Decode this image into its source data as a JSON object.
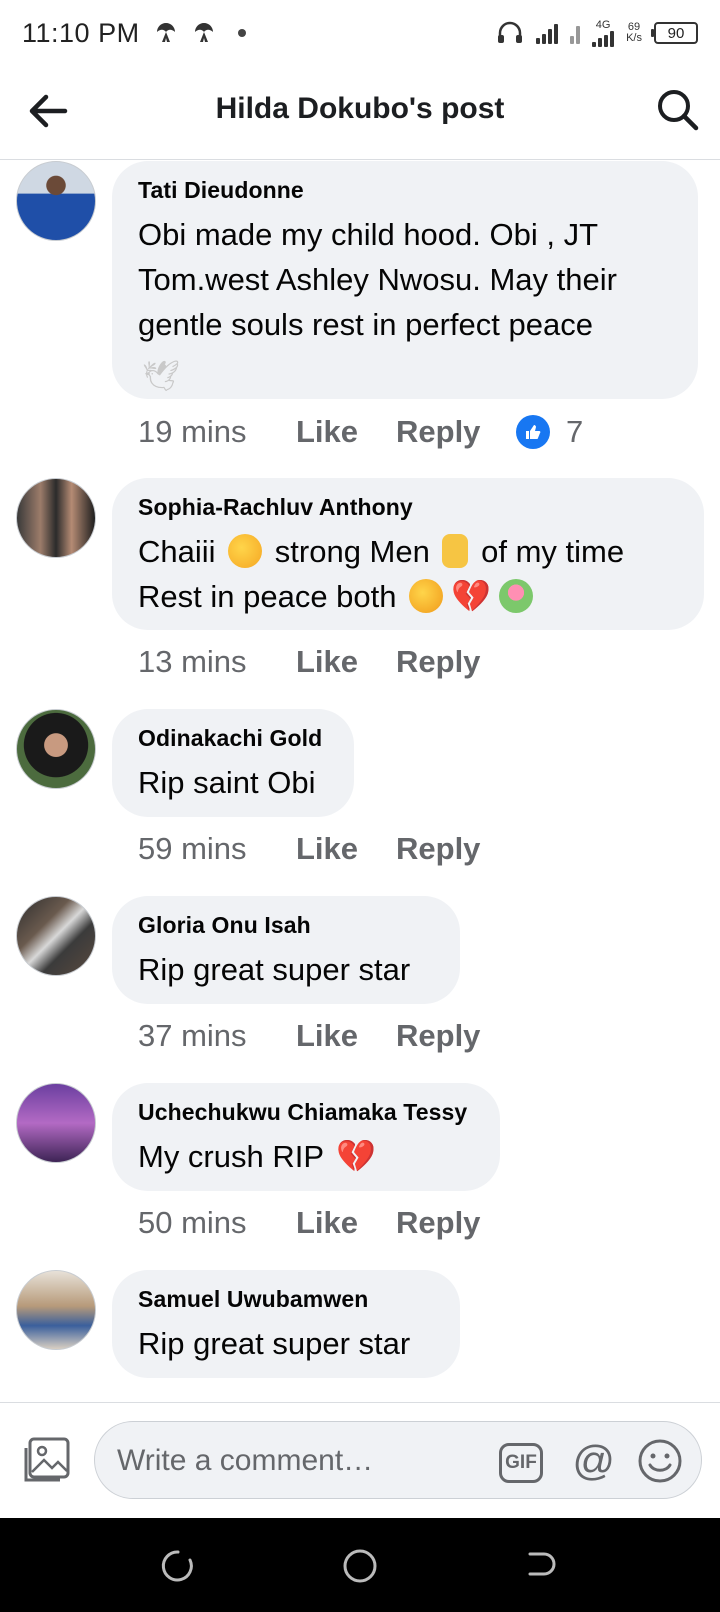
{
  "status_bar": {
    "time": "11:10 PM",
    "network_type": "4G",
    "speed_value": "69",
    "speed_unit": "K/s",
    "battery": "90"
  },
  "header": {
    "title": "Hilda Dokubo's post",
    "back_icon": "arrow-left-icon",
    "search_icon": "search-icon"
  },
  "comments": [
    {
      "author": "Tati Dieudonne",
      "text": "Obi made my child hood. Obi , JT Tom.west Ashley Nwosu. May their gentle souls rest in perfect peace",
      "time": "19 mins",
      "like": "Like",
      "reply": "Reply",
      "reaction_count": "7"
    },
    {
      "author": "Sophia-Rachluv Anthony",
      "text_parts": [
        "Chaiii",
        "strong Men",
        "of my time",
        "Rest in peace both"
      ],
      "time": "13 mins",
      "like": "Like",
      "reply": "Reply"
    },
    {
      "author": "Odinakachi Gold",
      "text": "Rip saint Obi",
      "time": "59 mins",
      "like": "Like",
      "reply": "Reply"
    },
    {
      "author": "Gloria Onu Isah",
      "text": "Rip great super star",
      "time": "37 mins",
      "like": "Like",
      "reply": "Reply"
    },
    {
      "author": "Uchechukwu Chiamaka Tessy",
      "text": "My crush RIP",
      "time": "50 mins",
      "like": "Like",
      "reply": "Reply"
    },
    {
      "author": "Samuel Uwubamwen",
      "text": "Rip great super star"
    }
  ],
  "composer": {
    "placeholder": "Write a comment…",
    "gif_label": "GIF",
    "at_label": "@"
  },
  "colors": {
    "bubble": "#f0f2f5",
    "meta": "#65676b",
    "like_blue": "#1877f2"
  }
}
